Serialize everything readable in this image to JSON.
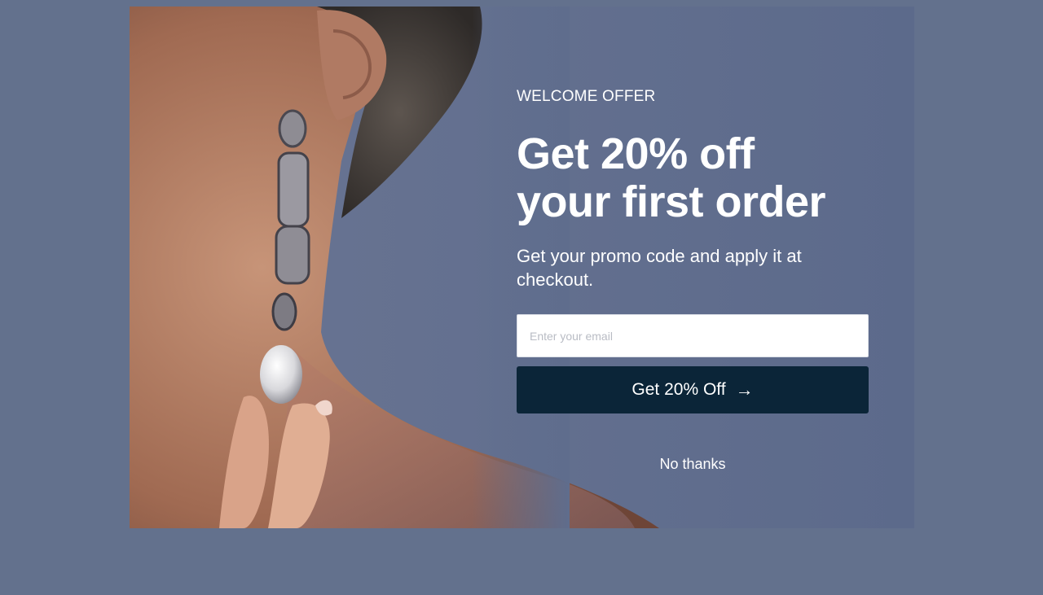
{
  "colors": {
    "backdrop": "#63718d",
    "modal_background": "#5f6d8d",
    "button_background": "#0b2538",
    "text": "#ffffff"
  },
  "popup": {
    "image": {
      "subject": "woman-wearing-pearl-drop-earring",
      "icon": "photo-image"
    },
    "eyebrow": "WELCOME OFFER",
    "headline_line1": "Get 20% off",
    "headline_line2": "your first order",
    "subtext": "Get your promo code and apply it at checkout.",
    "email_placeholder": "Enter your email",
    "email_value": "",
    "cta_label": "Get 20% Off",
    "cta_icon": "arrow-right-icon",
    "cta_arrow": "→",
    "dismiss_label": "No thanks"
  }
}
